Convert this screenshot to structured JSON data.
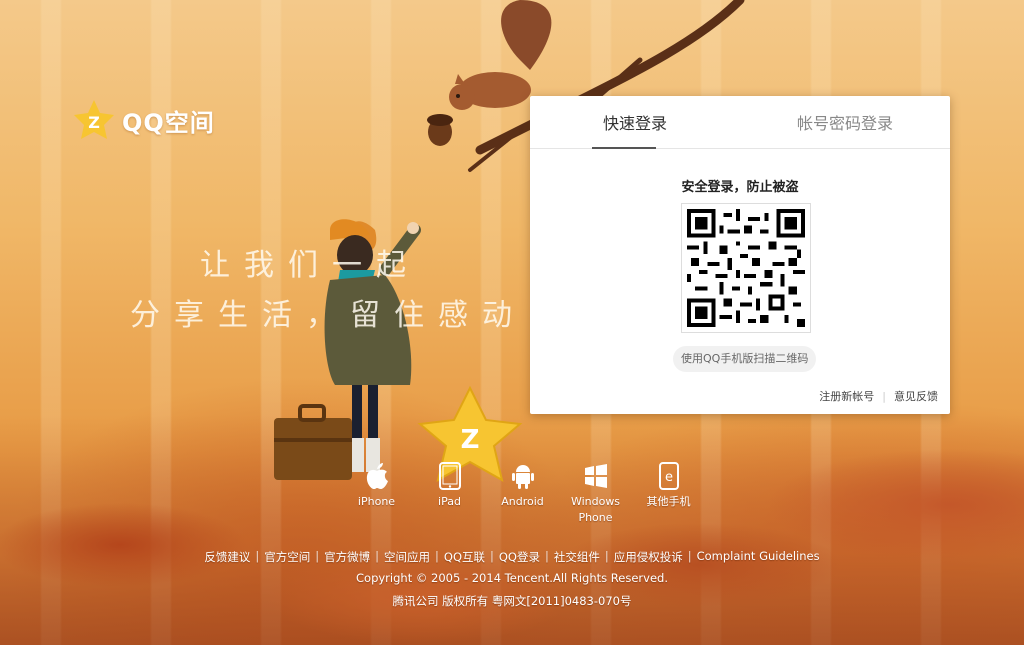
{
  "brand": {
    "logo_text": "QQ空间"
  },
  "slogan": {
    "line1": "让我们一起",
    "line2": "分享生活，留住感动"
  },
  "login": {
    "tabs": [
      {
        "label": "快速登录",
        "active": true
      },
      {
        "label": "帐号密码登录",
        "active": false
      }
    ],
    "qr_title": "安全登录，防止被盗",
    "qr_hint": "使用QQ手机版扫描二维码",
    "register_link": "注册新帐号",
    "feedback_link": "意见反馈"
  },
  "platforms": [
    {
      "label": "iPhone",
      "icon": "apple-icon"
    },
    {
      "label": "iPad",
      "icon": "tablet-icon"
    },
    {
      "label": "Android",
      "icon": "android-icon"
    },
    {
      "label": "Windows Phone",
      "icon": "windows-icon"
    },
    {
      "label": "其他手机",
      "icon": "phone-icon"
    }
  ],
  "footer": {
    "links": [
      "反馈建议",
      "官方空间",
      "官方微博",
      "空间应用",
      "QQ互联",
      "QQ登录",
      "社交组件",
      "应用侵权投诉",
      "Complaint Guidelines"
    ],
    "copyright": "Copyright © 2005 - 2014 Tencent.All Rights Reserved.",
    "license": "腾讯公司 版权所有 粤网文[2011]0483-070号"
  },
  "colors": {
    "accent_yellow": "#f7c531",
    "panel_bg": "#ffffff",
    "text_dark": "#333333"
  }
}
